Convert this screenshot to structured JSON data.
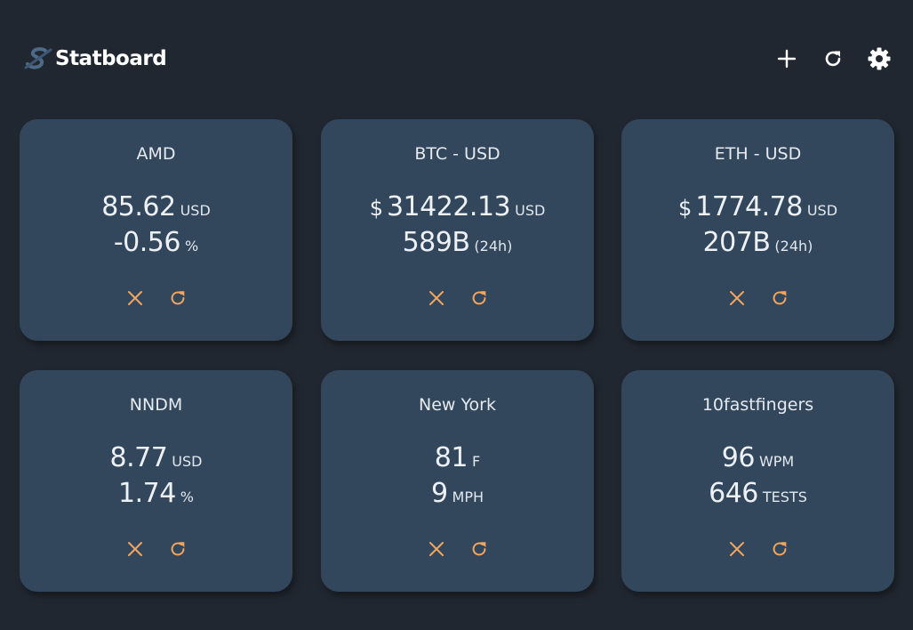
{
  "app": {
    "name": "Statboard",
    "logo_icon": "statboard-logo-icon"
  },
  "toolbar": {
    "add_icon": "plus-icon",
    "refresh_icon": "refresh-icon",
    "settings_icon": "gear-icon",
    "icon_color": "#ffffff"
  },
  "theme": {
    "background": "#212730",
    "card_background": "#32465c",
    "accent": "#f0a560"
  },
  "cards": [
    {
      "title": "AMD",
      "primary_prefix": "",
      "primary_value": "85.62",
      "primary_unit": "USD",
      "secondary_value": "-0.56",
      "secondary_unit": "%",
      "remove_icon": "close-icon",
      "refresh_icon": "refresh-icon"
    },
    {
      "title": "BTC - USD",
      "primary_prefix": "$",
      "primary_value": "31422.13",
      "primary_unit": "USD",
      "secondary_value": "589B",
      "secondary_unit": "(24h)",
      "remove_icon": "close-icon",
      "refresh_icon": "refresh-icon"
    },
    {
      "title": "ETH - USD",
      "primary_prefix": "$",
      "primary_value": "1774.78",
      "primary_unit": "USD",
      "secondary_value": "207B",
      "secondary_unit": "(24h)",
      "remove_icon": "close-icon",
      "refresh_icon": "refresh-icon"
    },
    {
      "title": "NNDM",
      "primary_prefix": "",
      "primary_value": "8.77",
      "primary_unit": "USD",
      "secondary_value": "1.74",
      "secondary_unit": "%",
      "remove_icon": "close-icon",
      "refresh_icon": "refresh-icon"
    },
    {
      "title": "New York",
      "primary_prefix": "",
      "primary_value": "81",
      "primary_unit": "F",
      "secondary_value": "9",
      "secondary_unit": "MPH",
      "remove_icon": "close-icon",
      "refresh_icon": "refresh-icon"
    },
    {
      "title": "10fastfingers",
      "primary_prefix": "",
      "primary_value": "96",
      "primary_unit": "WPM",
      "secondary_value": "646",
      "secondary_unit": "TESTS",
      "remove_icon": "close-icon",
      "refresh_icon": "refresh-icon"
    }
  ]
}
